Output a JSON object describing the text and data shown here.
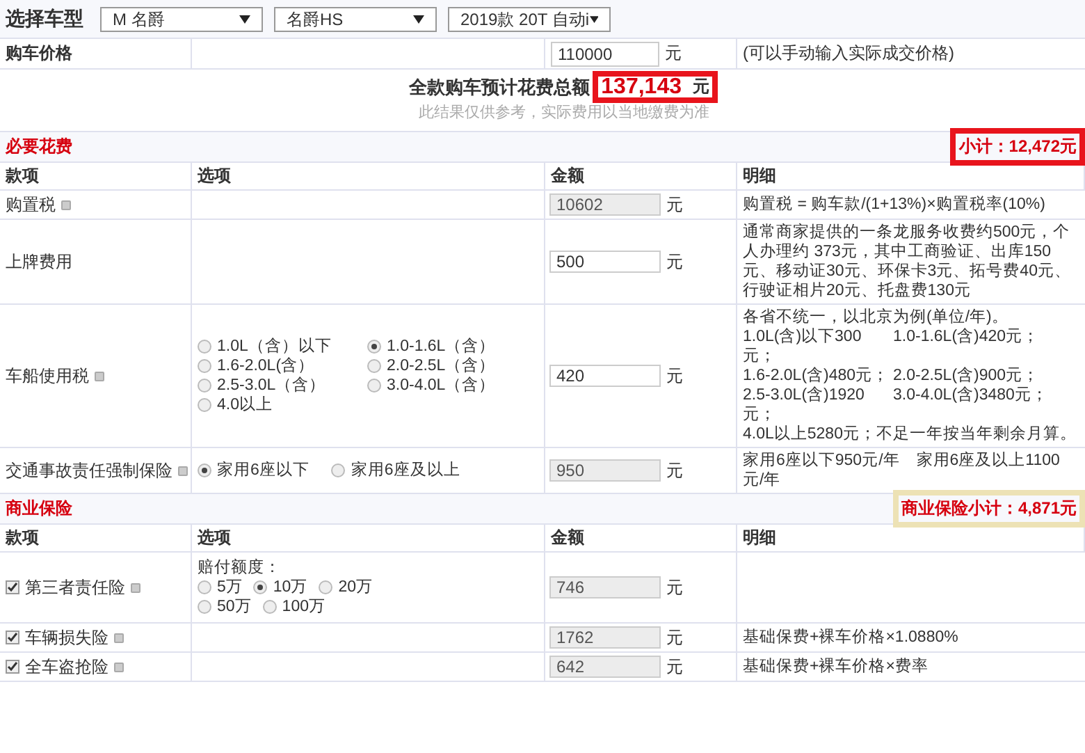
{
  "car_selector": {
    "label": "选择车型",
    "dropdowns": [
      {
        "value": "M 名爵"
      },
      {
        "value": "名爵HS"
      },
      {
        "value": "2019款 20T 自动i"
      }
    ]
  },
  "price": {
    "label": "购车价格",
    "value": "110000",
    "unit": "元",
    "note": "(可以手动输入实际成交价格)"
  },
  "total": {
    "label": "全款购车预计花费总额",
    "amount": "137,143",
    "unit": "元",
    "disclaimer": "此结果仅供参考，实际费用以当地缴费为准",
    "color": "#e8141c"
  },
  "sections": [
    {
      "title": "必要花费",
      "subtotal": "小计：12,472元",
      "color": "#e8141c",
      "columns": [
        "款项",
        "选项",
        "金额",
        "明细"
      ],
      "rows": [
        {
          "name": "购置税",
          "info": true,
          "amount": "10602",
          "readonly": true,
          "unit": "元",
          "detail": "购置税 = 购车款/(1+13%)×购置税率(10%)"
        },
        {
          "name": "上牌费用",
          "amount": "500",
          "readonly": false,
          "unit": "元",
          "detail": "通常商家提供的一条龙服务收费约500元，个人办理约 373元，其中工商验证、出库150元、移动证30元、环保卡3元、拓号费40元、行驶证相片20元、托盘费130元"
        },
        {
          "name": "车船使用税",
          "info": true,
          "options": [
            {
              "label": "1.0L（含）以下",
              "selected": false
            },
            {
              "label": "1.0-1.6L（含）",
              "selected": true
            },
            {
              "label": "1.6-2.0L(含）",
              "selected": false
            },
            {
              "label": "2.0-2.5L（含）",
              "selected": false
            },
            {
              "label": "2.5-3.0L（含）",
              "selected": false
            },
            {
              "label": "3.0-4.0L（含）",
              "selected": false
            },
            {
              "label": "4.0以上",
              "selected": false
            }
          ],
          "amount": "420",
          "readonly": false,
          "unit": "元",
          "detail": "各省不统一，以北京为例(单位/年)。",
          "detail_rates": [
            "1.0L(含)以下300元；",
            "1.0-1.6L(含)420元；",
            "1.6-2.0L(含)480元；",
            "2.0-2.5L(含)900元；",
            "2.5-3.0L(含)1920元；",
            "3.0-4.0L(含)3480元；"
          ],
          "detail_footer": "4.0L以上5280元；不足一年按当年剩余月算。"
        },
        {
          "name": "交通事故责任强制保险",
          "info": true,
          "options": [
            {
              "label": "家用6座以下",
              "selected": true
            },
            {
              "label": "家用6座及以上",
              "selected": false
            }
          ],
          "amount": "950",
          "readonly": true,
          "unit": "元",
          "detail": "家用6座以下950元/年　家用6座及以上1100元/年"
        }
      ]
    },
    {
      "title": "商业保险",
      "subtotal": "商业保险小计：4,871元",
      "color": "#ede2b5",
      "columns": [
        "款项",
        "选项",
        "金额",
        "明细"
      ],
      "rows": [
        {
          "name": "第三者责任险",
          "checked": true,
          "info": true,
          "options_label": "赔付额度：",
          "options": [
            {
              "label": "5万",
              "selected": false
            },
            {
              "label": "10万",
              "selected": true
            },
            {
              "label": "20万",
              "selected": false
            },
            {
              "label": "50万",
              "selected": false
            },
            {
              "label": "100万",
              "selected": false
            }
          ],
          "amount": "746",
          "readonly": true,
          "unit": "元"
        },
        {
          "name": "车辆损失险",
          "checked": true,
          "info": true,
          "amount": "1762",
          "readonly": true,
          "unit": "元",
          "detail": "基础保费+裸车价格×1.0880%"
        },
        {
          "name": "全车盗抢险",
          "checked": true,
          "info": true,
          "amount": "642",
          "readonly": true,
          "unit": "元",
          "detail": "基础保费+裸车价格×费率"
        }
      ]
    }
  ]
}
